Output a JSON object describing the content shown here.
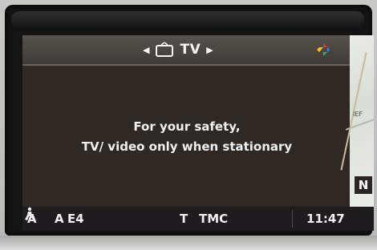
{
  "header": {
    "source_label": "TV",
    "prev_icon": "left-arrow-icon",
    "next_icon": "right-arrow-icon",
    "tv_icon": "tv-icon",
    "color_icon": "color-setting-icon"
  },
  "message": {
    "line1": "For your safety,",
    "line2": "TV/ video only when stationary"
  },
  "map": {
    "fragment_text": "IEF",
    "compass_label": "N"
  },
  "status_bar": {
    "item1": "A",
    "item2": "A",
    "item3": "E4",
    "traffic_flag": "T",
    "tmc_label": "TMC",
    "time": "11:47"
  },
  "colors": {
    "screen_background": "#2e2722",
    "header_background": "#4a453f",
    "status_background": "#1f1c20",
    "text": "#f2f2f2"
  }
}
